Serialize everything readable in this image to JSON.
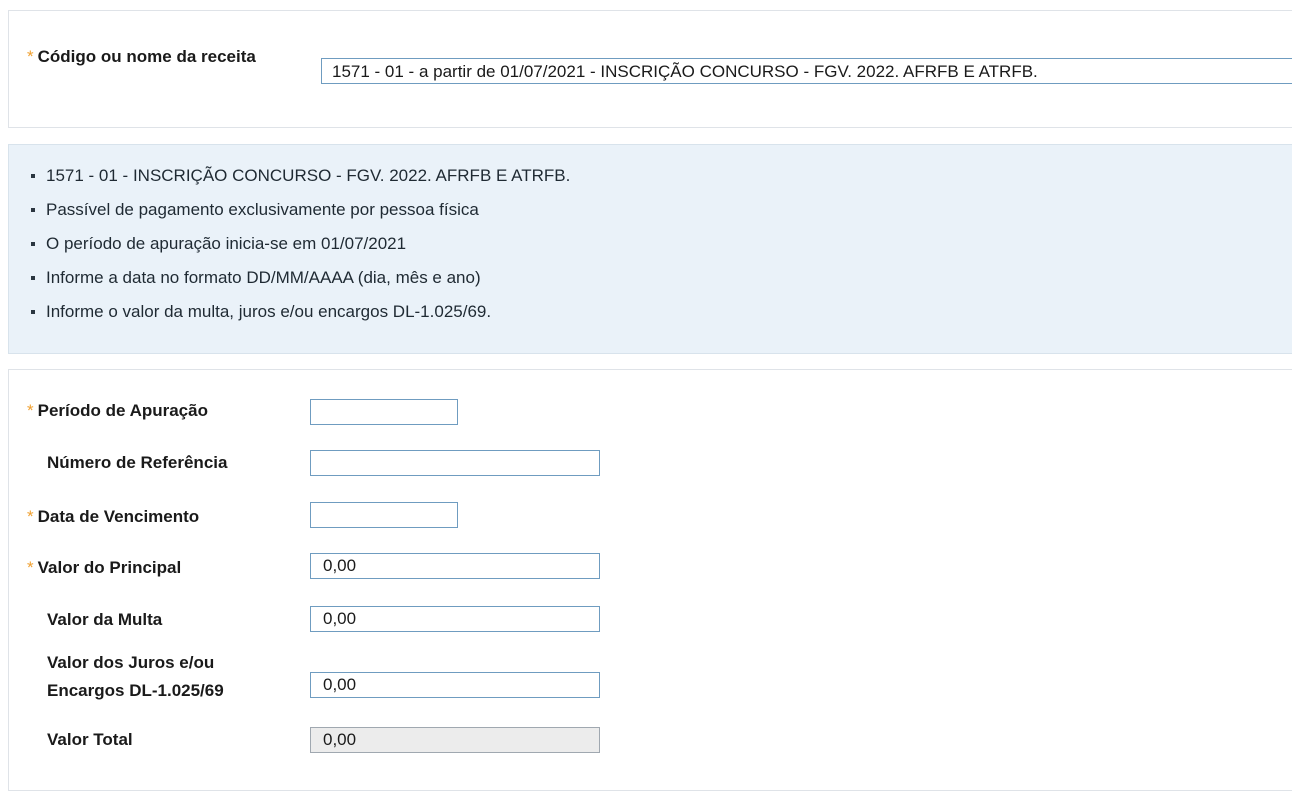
{
  "receita": {
    "label": "Código ou nome da receita",
    "value": "1571 - 01 - a partir de 01/07/2021 - INSCRIÇÃO CONCURSO - FGV. 2022. AFRFB E ATRFB."
  },
  "info": {
    "items": [
      "1571 - 01 - INSCRIÇÃO CONCURSO - FGV. 2022. AFRFB E ATRFB.",
      "Passível de pagamento exclusivamente por pessoa física",
      "O período de apuração inicia-se em 01/07/2021",
      "Informe a data no formato DD/MM/AAAA (dia, mês e ano)",
      "Informe o valor da multa, juros e/ou encargos DL-1.025/69."
    ]
  },
  "form": {
    "periodo_label": "Período de Apuração",
    "periodo_value": "",
    "referencia_label": "Número de Referência",
    "referencia_value": "",
    "vencimento_label": "Data de Vencimento",
    "vencimento_value": "",
    "principal_label": "Valor do Principal",
    "principal_value": "0,00",
    "multa_label": "Valor da Multa",
    "multa_value": "0,00",
    "juros_label_line1": "Valor dos Juros e/ou",
    "juros_label_line2": "Encargos DL-1.025/69",
    "juros_value": "0,00",
    "total_label": "Valor Total",
    "total_value": "0,00"
  },
  "colors": {
    "required_star": "#f0a030",
    "info_background": "#eaf2f9",
    "input_border": "#6f9cc0"
  },
  "icons": {
    "required": "asterisk-icon",
    "bullet": "square-bullet-icon"
  }
}
